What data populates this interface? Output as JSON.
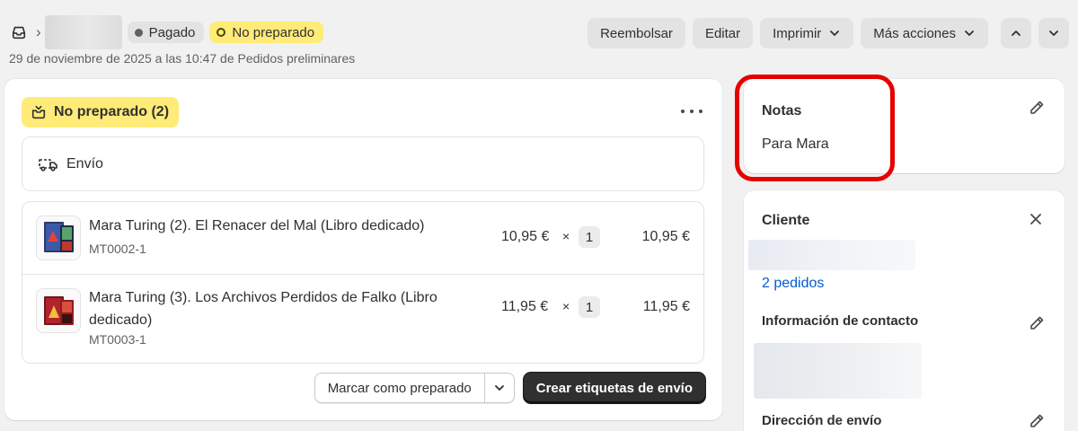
{
  "header": {
    "order_status_paid": "Pagado",
    "order_status_fulfillment": "No preparado",
    "subtitle": "29 de noviembre de 2025 a las 10:47 de Pedidos preliminares",
    "breadcrumb_separator": "›",
    "actions": {
      "refund": "Reembolsar",
      "edit": "Editar",
      "print": "Imprimir",
      "more": "Más acciones"
    }
  },
  "fulfillment": {
    "status_label": "No preparado (2)",
    "shipping_label": "Envío",
    "items": [
      {
        "title": "Mara Turing (2). El Renacer del Mal (Libro dedicado)",
        "sku": "MT0002-1",
        "price": "10,95 €",
        "times": "×",
        "quantity": "1",
        "total": "10,95 €"
      },
      {
        "title": "Mara Turing (3). Los Archivos Perdidos de Falko (Libro dedicado)",
        "sku": "MT0003-1",
        "price": "11,95 €",
        "times": "×",
        "quantity": "1",
        "total": "11,95 €"
      }
    ],
    "mark_fulfilled_label": "Marcar como preparado",
    "create_labels_label": "Crear etiquetas de envío"
  },
  "notes": {
    "title": "Notas",
    "text": "Para Mara"
  },
  "customer": {
    "title": "Cliente",
    "orders_link": "2 pedidos",
    "contact_title": "Información de contacto",
    "shipping_address_title": "Dirección de envío"
  },
  "colors": {
    "page_bg": "#f1f1f1",
    "badge_yellow": "#ffeb78",
    "link_blue": "#005bd3",
    "highlight_red": "#e60000",
    "primary_button": "#303030"
  },
  "icons": {
    "inbox": "inbox-icon",
    "fulfillment": "package-icon",
    "shipping": "truck-icon",
    "more": "more-horizontal-icon",
    "edit": "pencil-icon",
    "close": "close-icon",
    "chevron_down": "chevron-down-icon",
    "chevron_up": "chevron-up-icon"
  }
}
